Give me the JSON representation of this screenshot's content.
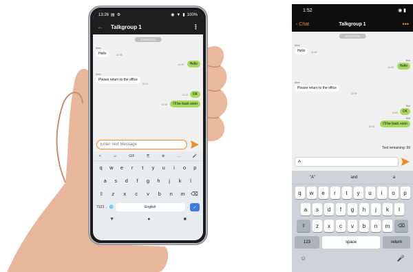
{
  "android": {
    "status": {
      "time": "13:26",
      "battery": "100%"
    },
    "header": {
      "title": "Talkgroup 1"
    },
    "date": "2024/01/01",
    "messages": [
      {
        "sender": "Alice",
        "text": "Hello",
        "time": "11:04",
        "direction": "in"
      },
      {
        "sender": "",
        "text": "Hello",
        "time": "11:10",
        "direction": "out"
      },
      {
        "sender": "Alice",
        "text": "Please return to the office",
        "time": "11:11",
        "direction": "in"
      },
      {
        "sender": "",
        "text": "OK",
        "time": "11:12",
        "direction": "out"
      },
      {
        "sender": "",
        "text": "I'll be back soon",
        "time": "11:13",
        "direction": "out"
      }
    ],
    "input": {
      "placeholder": "Enter Text Message"
    },
    "keyboard": {
      "toolbar": [
        "<",
        "☺",
        "GIF",
        "⎘",
        "⚙",
        "…",
        "🎤"
      ],
      "row1": [
        "q",
        "w",
        "e",
        "r",
        "t",
        "y",
        "u",
        "i",
        "o",
        "p"
      ],
      "row2": [
        "a",
        "s",
        "d",
        "f",
        "g",
        "h",
        "j",
        "k",
        "l"
      ],
      "row3": [
        "⇧",
        "z",
        "x",
        "c",
        "v",
        "b",
        "n",
        "m",
        "⌫"
      ],
      "bottom": {
        "symbols": "?123",
        "comma": ",",
        "globe": "🌐",
        "space": "English",
        "period": ".",
        "done": "✓"
      },
      "nav": [
        "▼",
        "●",
        "■"
      ]
    }
  },
  "iphone": {
    "status": {
      "time": "1:52"
    },
    "header": {
      "back": "Chat",
      "title": "Talkgroup 1",
      "more": "•••"
    },
    "date": "2024/01/01",
    "messages": [
      {
        "sender": "Alice",
        "text": "Hello",
        "time": "11:02",
        "direction": "in"
      },
      {
        "sender": "Bob",
        "text": "Hello",
        "time": "11:02",
        "direction": "out"
      },
      {
        "sender": "Alice",
        "text": "Please return to the office",
        "time": "11:03",
        "direction": "in"
      },
      {
        "sender": "Bob",
        "text": "OK",
        "time": "11:03",
        "direction": "out"
      },
      {
        "sender": "Bob",
        "text": "I'll be back soon",
        "time": "11:03",
        "direction": "out"
      }
    ],
    "remaining": "Text remaining: 99",
    "input": {
      "value": "A"
    },
    "keyboard": {
      "suggestions": [
        "\"A\"",
        "and",
        "a"
      ],
      "row1": [
        "q",
        "w",
        "e",
        "r",
        "t",
        "y",
        "u",
        "i",
        "o",
        "p"
      ],
      "row2": [
        "a",
        "s",
        "d",
        "f",
        "g",
        "h",
        "j",
        "k",
        "l"
      ],
      "row3": [
        "⇧",
        "z",
        "x",
        "c",
        "v",
        "b",
        "n",
        "m",
        "⌫"
      ],
      "bottom": {
        "numbers": "123",
        "space": "space",
        "return": "return"
      },
      "extra": [
        "☺",
        "🎤"
      ]
    }
  },
  "colors": {
    "accent": "#f08a24",
    "outgoing_bubble": "#a7d85f",
    "chat_bg": "#f0f0f0"
  }
}
